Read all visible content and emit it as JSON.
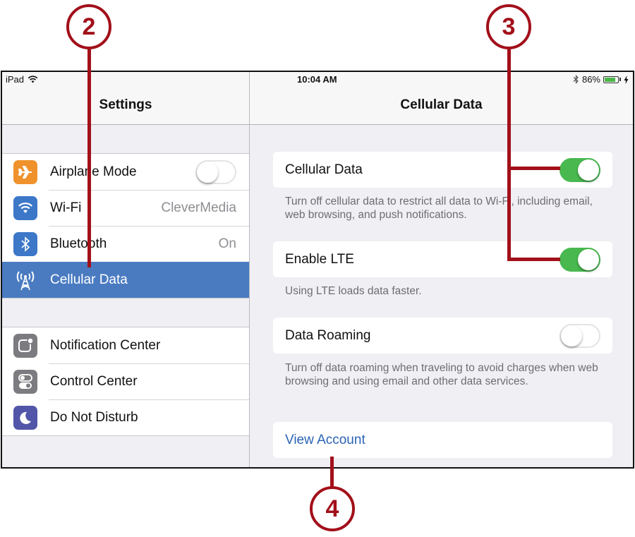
{
  "status_bar": {
    "device": "iPad",
    "time": "10:04 AM",
    "battery_percent": "86%",
    "battery_level": 0.86,
    "icons": [
      "wifi-icon",
      "bluetooth-icon",
      "battery-icon",
      "charging-icon"
    ]
  },
  "master": {
    "title": "Settings",
    "groups": [
      [
        {
          "label": "Airplane Mode",
          "icon": "airplane-icon",
          "icon_color": "#f0922c",
          "toggle": false
        },
        {
          "label": "Wi-Fi",
          "icon": "wifi-icon",
          "icon_color": "#3c77c8",
          "value": "CleverMedia"
        },
        {
          "label": "Bluetooth",
          "icon": "bluetooth-icon",
          "icon_color": "#3c77c8",
          "value": "On"
        },
        {
          "label": "Cellular Data",
          "icon": "cellular-antenna-icon",
          "icon_color": "#4a7bc1",
          "selected": true
        }
      ],
      [
        {
          "label": "Notification Center",
          "icon": "notification-center-icon",
          "icon_color": "#7c7c80"
        },
        {
          "label": "Control Center",
          "icon": "control-center-icon",
          "icon_color": "#7c7c80"
        },
        {
          "label": "Do Not Disturb",
          "icon": "moon-icon",
          "icon_color": "#5156a8"
        }
      ]
    ]
  },
  "detail": {
    "title": "Cellular Data",
    "cellular_data": {
      "label": "Cellular Data",
      "on": true,
      "footer": "Turn off cellular data to restrict all data to Wi-Fi, including email, web browsing, and push notifications."
    },
    "enable_lte": {
      "label": "Enable LTE",
      "on": true,
      "footer": "Using LTE loads data faster."
    },
    "data_roaming": {
      "label": "Data Roaming",
      "on": false,
      "footer": "Turn off data roaming when traveling to avoid charges when web browsing and using email and other data services."
    },
    "view_account": {
      "label": "View Account"
    }
  },
  "callouts": [
    "2",
    "3",
    "4"
  ],
  "colors": {
    "accent": "#4a7bc1",
    "link": "#2a63b5",
    "toggle_on": "#48b84f",
    "callout": "#a2101a"
  }
}
